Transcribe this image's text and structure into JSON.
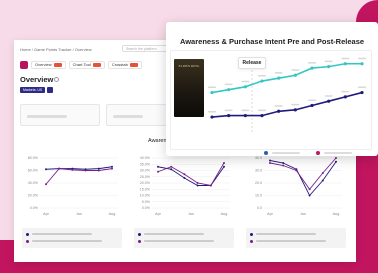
{
  "colors": {
    "brand": "#c2155f",
    "teal": "#33c7c4",
    "navy": "#1f1b7a",
    "purple": "#7a1f8a",
    "accent_tag": "#e5533a",
    "poster_text": "#d7c28a"
  },
  "breadcrumb": "Home / Game Points Tracker / Overview",
  "search_placeholder": "Search the platform",
  "tabs": [
    {
      "label": "Overview"
    },
    {
      "label": "Chart Tool"
    },
    {
      "label": "Crosstab"
    }
  ],
  "overview": {
    "title": "Overview",
    "market_label": "Markets: US"
  },
  "section_title": "Awareness",
  "mini_charts": [
    {
      "y_ticks": [
        "80.0%",
        "60.0%",
        "40.0%",
        "20.0%",
        "0.0%"
      ],
      "x_ticks": [
        "Apr",
        "Jun",
        "Aug"
      ]
    },
    {
      "y_ticks": [
        "40.0%",
        "35.0%",
        "30.0%",
        "25.0%",
        "20.0%",
        "15.0%",
        "10.0%",
        "5.0%",
        "0.0%"
      ],
      "x_ticks": [
        "Apr",
        "Jun",
        "Aug"
      ]
    },
    {
      "y_ticks": [
        "40.0",
        "30.0",
        "20.0",
        "10.0",
        "0.0"
      ],
      "x_ticks": [
        "Apr",
        "Jun",
        "Aug"
      ]
    }
  ],
  "popup": {
    "title": "Awareness & Purchase Intent Pre and Post-Release",
    "release_label": "Release",
    "poster_text": "ELDEN RING"
  },
  "chart_data": [
    {
      "type": "line",
      "title": "Awareness & Purchase Intent Pre and Post-Release",
      "x": [
        1,
        2,
        3,
        4,
        5,
        6,
        7,
        8,
        9,
        10
      ],
      "series": [
        {
          "color": "#33c7c4",
          "values": [
            26,
            28,
            30,
            34,
            36,
            38,
            43,
            44,
            46,
            46
          ]
        },
        {
          "color": "#1f1b7a",
          "values": [
            9,
            10,
            10,
            10,
            13,
            14,
            17,
            20,
            23,
            26
          ]
        }
      ],
      "annotations": [
        "Release"
      ],
      "ylim": [
        0,
        50
      ]
    },
    {
      "type": "line",
      "x_ticks": [
        "Apr",
        "Jun",
        "Aug"
      ],
      "y_ticks": [
        "80.0%",
        "60.0%",
        "40.0%",
        "20.0%",
        "0.0%"
      ],
      "series": [
        {
          "color": "#1f1b7a",
          "values": [
            62,
            63,
            63,
            62,
            63,
            66
          ]
        },
        {
          "color": "#7a1f8a",
          "values": [
            38,
            63,
            61,
            60,
            60,
            63
          ]
        }
      ],
      "ylim": [
        0,
        80
      ]
    },
    {
      "type": "line",
      "x_ticks": [
        "Apr",
        "Jun",
        "Aug"
      ],
      "y_ticks": [
        "40.0%",
        "35.0%",
        "30.0%",
        "25.0%",
        "20.0%",
        "15.0%",
        "10.0%",
        "5.0%",
        "0.0%"
      ],
      "series": [
        {
          "color": "#1f1b7a",
          "values": [
            33,
            31,
            24,
            18,
            18,
            33
          ]
        },
        {
          "color": "#7a1f8a",
          "values": [
            29,
            33,
            27,
            20,
            18,
            36
          ]
        }
      ],
      "ylim": [
        0,
        40
      ]
    },
    {
      "type": "line",
      "x_ticks": [
        "Apr",
        "Jun",
        "Aug"
      ],
      "y_ticks": [
        "40.0",
        "30.0",
        "20.0",
        "10.0",
        "0.0"
      ],
      "series": [
        {
          "color": "#1f1b7a",
          "values": [
            38,
            36,
            31,
            10,
            22,
            37
          ]
        },
        {
          "color": "#7a1f8a",
          "values": [
            36,
            34,
            30,
            15,
            28,
            40
          ]
        }
      ],
      "ylim": [
        0,
        40
      ]
    }
  ]
}
